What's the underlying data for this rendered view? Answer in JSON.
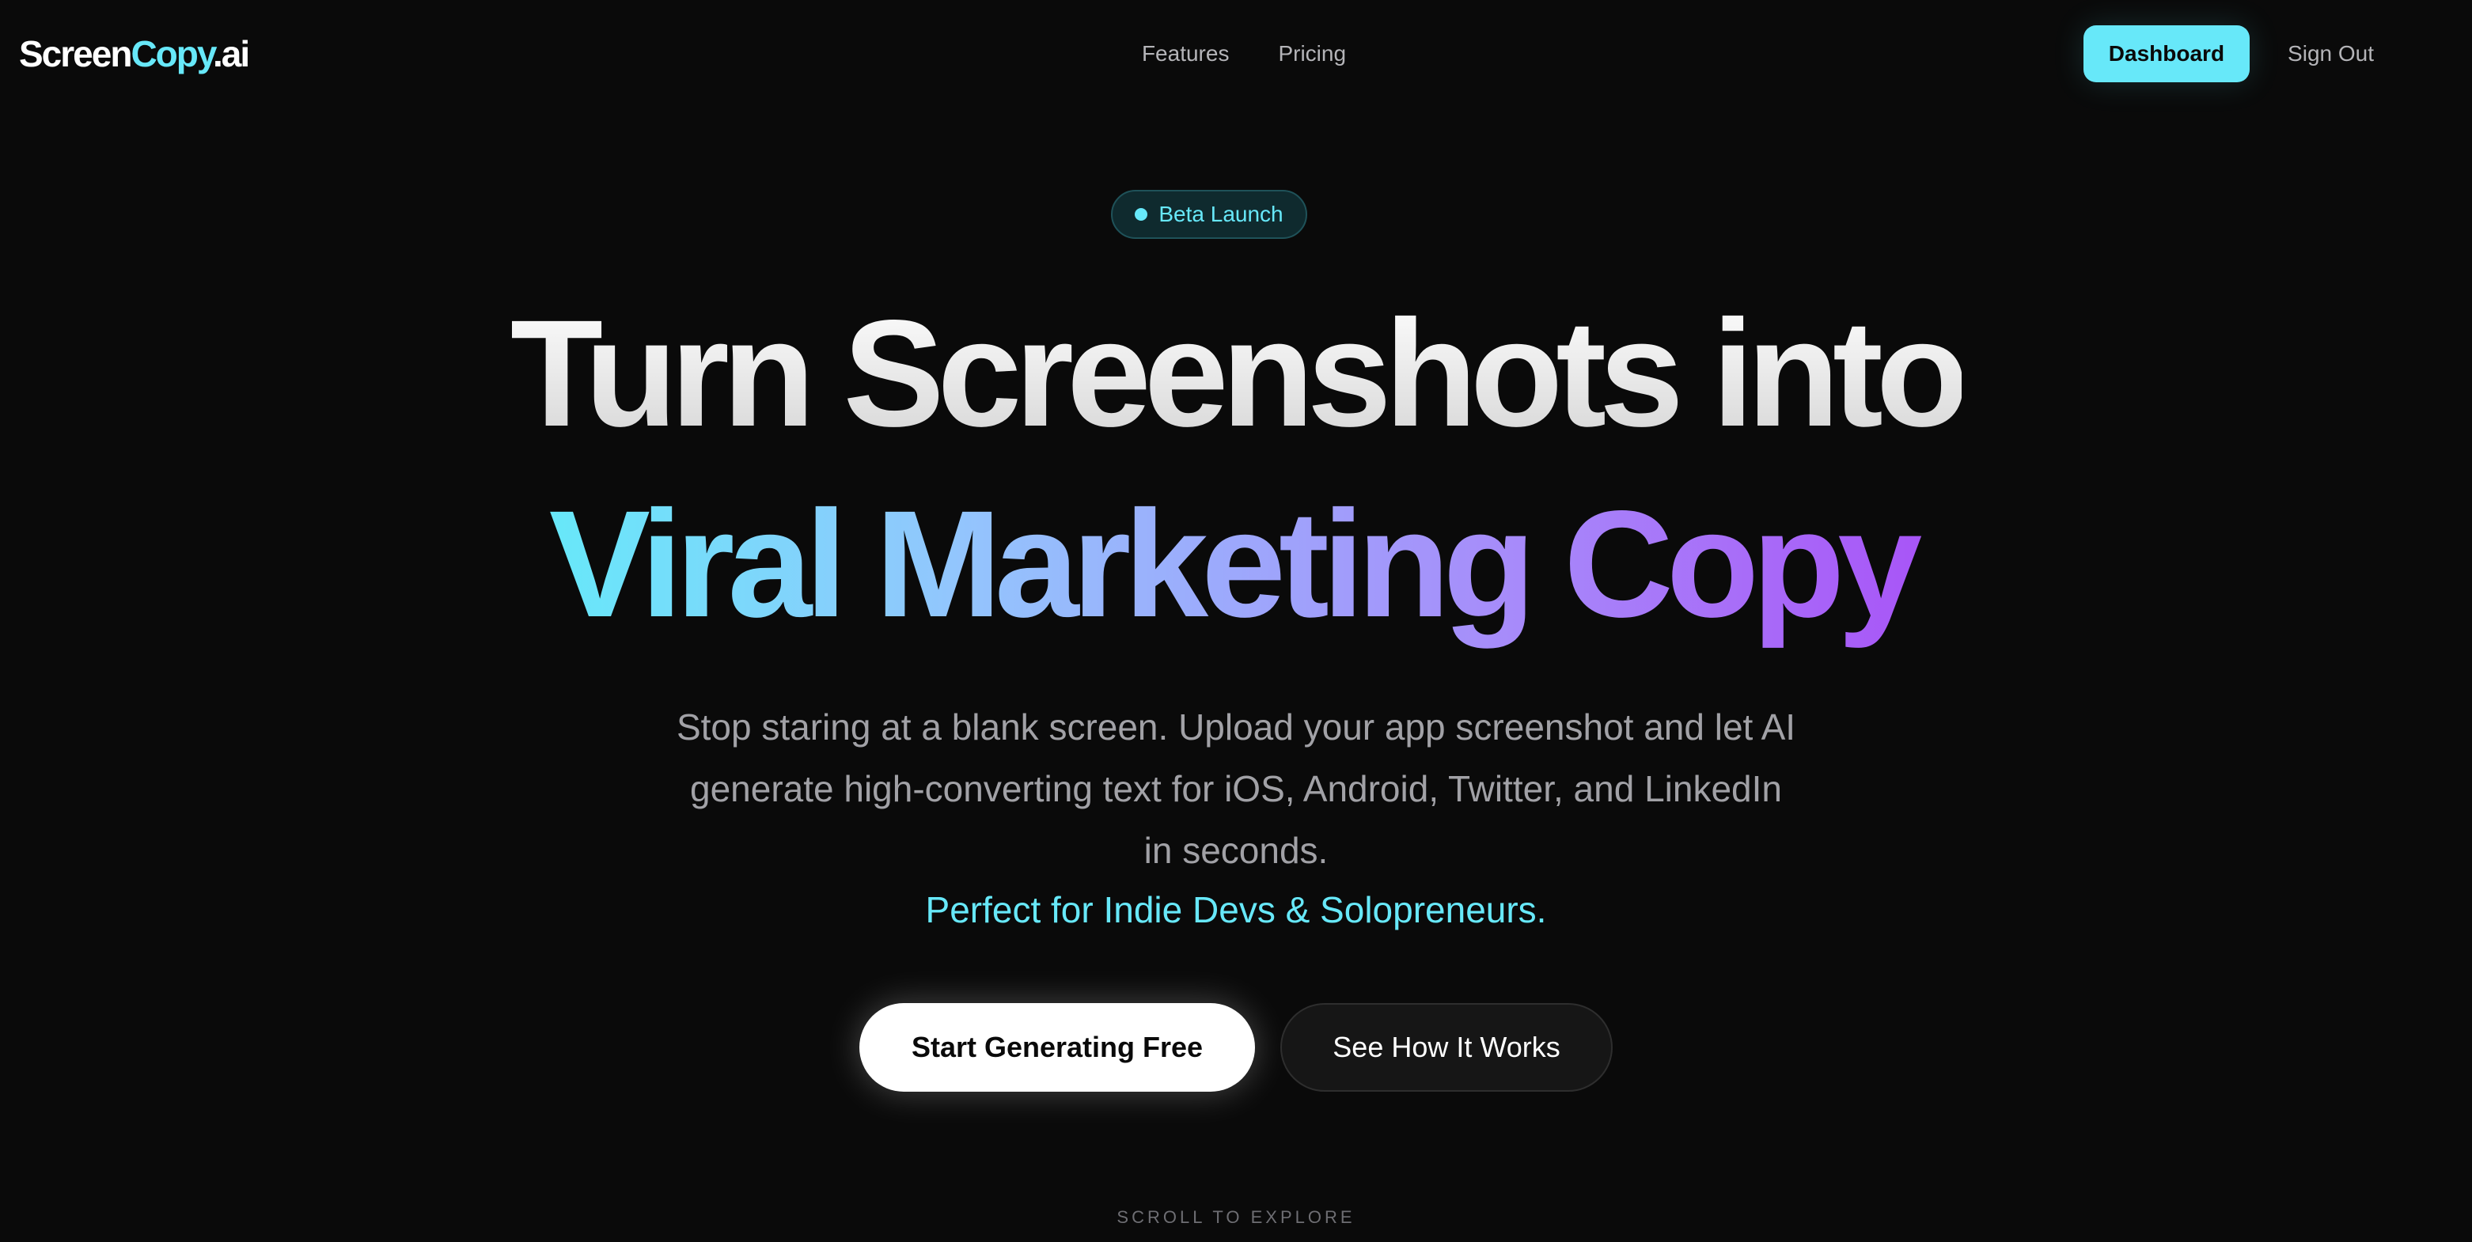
{
  "header": {
    "logo": {
      "part1": "Screen",
      "part2": "Copy",
      "part3": ".ai"
    },
    "nav": [
      {
        "label": "Features"
      },
      {
        "label": "Pricing"
      }
    ],
    "dashboard_label": "Dashboard",
    "signout_label": "Sign Out"
  },
  "hero": {
    "badge": "Beta Launch",
    "headline_line1": "Turn Screenshots into",
    "headline_line2": "Viral Marketing Copy",
    "subtext": "Stop staring at a blank screen. Upload your app screenshot and let AI generate high-converting text for iOS, Android, Twitter, and LinkedIn in seconds.",
    "tagline": "Perfect for Indie Devs & Solopreneurs.",
    "primary_cta": "Start Generating Free",
    "secondary_cta": "See How It Works",
    "scroll_hint": "SCROLL TO EXPLORE"
  },
  "colors": {
    "background": "#0a0a0a",
    "accent": "#67e8f9",
    "gradient_end": "#a855f7"
  }
}
